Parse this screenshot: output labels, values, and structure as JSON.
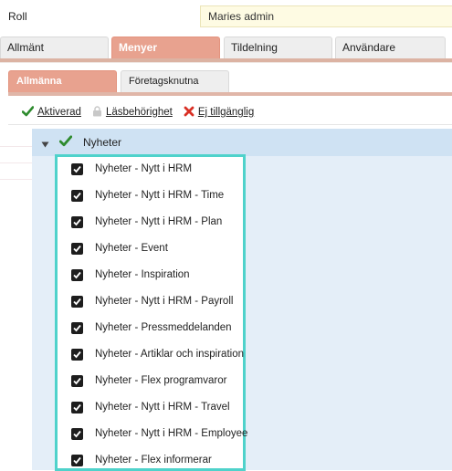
{
  "role": {
    "label": "Roll",
    "value": "Maries admin"
  },
  "main_tabs": [
    {
      "label": "Allmänt",
      "active": false
    },
    {
      "label": "Menyer",
      "active": true
    },
    {
      "label": "Tildelning",
      "active": false
    },
    {
      "label": "Användare",
      "active": false
    }
  ],
  "sub_tabs": [
    {
      "label": "Allmänna",
      "active": true
    },
    {
      "label": "Företagsknutna",
      "active": false
    }
  ],
  "legend": {
    "activated": "Aktiverad",
    "read_permission": "Läsbehörighet",
    "unavailable": "Ej tillgänglig"
  },
  "tree": {
    "group_label": "Nyheter",
    "items": [
      {
        "label": "Nyheter - Nytt i HRM",
        "checked": true
      },
      {
        "label": "Nyheter - Nytt i HRM - Time",
        "checked": true
      },
      {
        "label": "Nyheter - Nytt i HRM - Plan",
        "checked": true
      },
      {
        "label": "Nyheter - Event",
        "checked": true
      },
      {
        "label": "Nyheter - Inspiration",
        "checked": true
      },
      {
        "label": "Nyheter - Nytt i HRM - Payroll",
        "checked": true
      },
      {
        "label": "Nyheter - Pressmeddelanden",
        "checked": true
      },
      {
        "label": "Nyheter - Artiklar och inspiration",
        "checked": true
      },
      {
        "label": "Nyheter - Flex programvaror",
        "checked": true
      },
      {
        "label": "Nyheter - Nytt i HRM - Travel",
        "checked": true
      },
      {
        "label": "Nyheter - Nytt i HRM - Employee",
        "checked": true
      },
      {
        "label": "Nyheter - Flex informerar",
        "checked": true
      }
    ]
  },
  "colors": {
    "active_tab": "#e8a28f",
    "highlight_border": "#4fd2cb",
    "tree_header": "#cfe2f3",
    "check_green": "#2e8b2e",
    "cross_red": "#d93025"
  }
}
